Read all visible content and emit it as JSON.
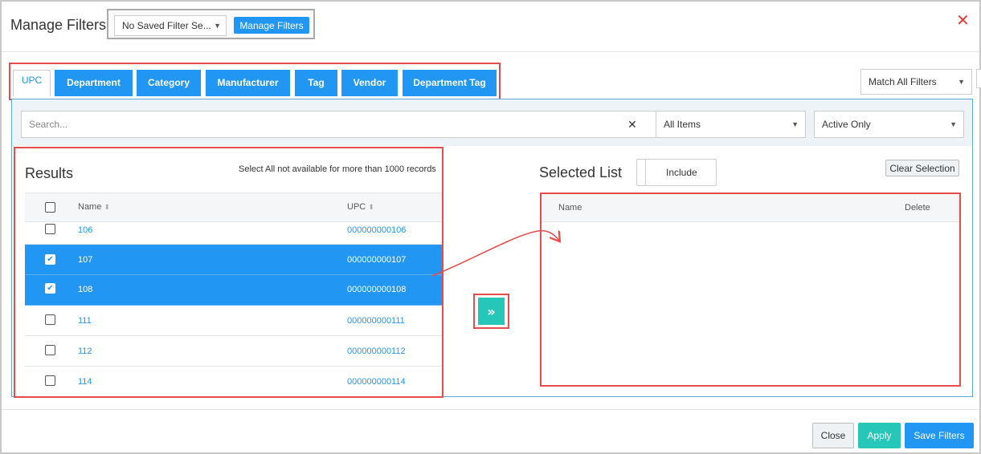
{
  "header": {
    "title": "Manage Filters",
    "saved_filter_value": "No Saved Filter Se...",
    "manage_filters_label": "Manage Filters",
    "close_glyph": "✕"
  },
  "tabs": [
    {
      "label": "UPC",
      "active": true
    },
    {
      "label": "Department"
    },
    {
      "label": "Category"
    },
    {
      "label": "Manufacturer"
    },
    {
      "label": "Tag"
    },
    {
      "label": "Vendor"
    },
    {
      "label": "Department Tag"
    }
  ],
  "match_select": {
    "value": "Match All Filters"
  },
  "search": {
    "placeholder": "Search...",
    "items_select": "All Items",
    "status_select": "Active Only"
  },
  "results": {
    "title": "Results",
    "note": "Select All not available for more than 1000 records",
    "columns": {
      "name": "Name",
      "upc": "UPC"
    },
    "rows": [
      {
        "name": "106",
        "upc": "000000000106",
        "checked": false
      },
      {
        "name": "107",
        "upc": "000000000107",
        "checked": true
      },
      {
        "name": "108",
        "upc": "000000000108",
        "checked": true
      },
      {
        "name": "111",
        "upc": "000000000111",
        "checked": false
      },
      {
        "name": "112",
        "upc": "000000000112",
        "checked": false
      },
      {
        "name": "114",
        "upc": "000000000114",
        "checked": false
      }
    ]
  },
  "move_button": {
    "glyph": "»"
  },
  "selected_list": {
    "title": "Selected List",
    "toggle_label": "Include",
    "clear_label": "Clear Selection",
    "columns": {
      "name": "Name",
      "delete": "Delete"
    }
  },
  "footer": {
    "close_label": "Close",
    "apply_label": "Apply",
    "save_label": "Save Filters"
  },
  "colors": {
    "primary": "#2196f3",
    "teal": "#26c6b8",
    "annotation_red": "#e84b4b"
  }
}
